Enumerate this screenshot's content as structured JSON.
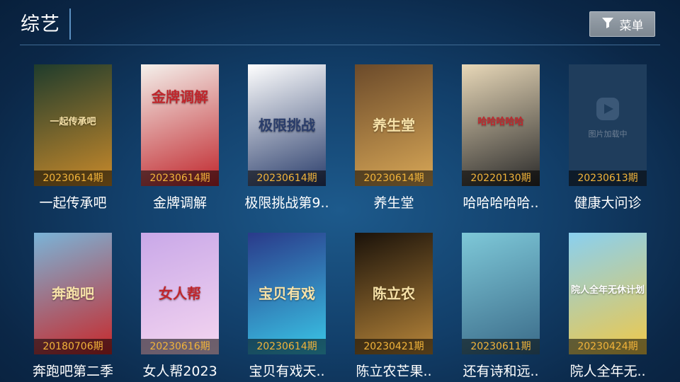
{
  "header": {
    "title": "综艺",
    "menu_label": "菜单",
    "menu_icon": "filter-icon"
  },
  "items": [
    {
      "title": "一起传承吧",
      "episode": "20230614期",
      "poster_text": "一起传承吧",
      "colors": [
        "#1f3c2c",
        "#c98a2b"
      ]
    },
    {
      "title": "金牌调解",
      "episode": "20230614期",
      "poster_text": "金牌调解",
      "colors": [
        "#f4f1ec",
        "#c0262c"
      ]
    },
    {
      "title": "极限挑战第9..",
      "episode": "20230614期",
      "poster_text": "极限挑战",
      "colors": [
        "#ffffff",
        "#2a3d6b"
      ]
    },
    {
      "title": "养生堂",
      "episode": "20230614期",
      "poster_text": "养生堂",
      "colors": [
        "#6b4a2a",
        "#d9a857"
      ]
    },
    {
      "title": "哈哈哈哈哈..",
      "episode": "20220130期",
      "poster_text": "哈哈哈哈哈",
      "colors": [
        "#e8d8b8",
        "#2a2a2a"
      ]
    },
    {
      "title": "健康大问诊",
      "episode": "20230613期",
      "poster_text": "图片加载中",
      "colors": [
        "#1d3a5a",
        "#2a4a6a"
      ]
    },
    {
      "title": "奔跑吧第二季",
      "episode": "20180706期",
      "poster_text": "奔跑吧",
      "colors": [
        "#7ab4d8",
        "#c8282a"
      ]
    },
    {
      "title": "女人帮2023",
      "episode": "20230616期",
      "poster_text": "女人帮",
      "colors": [
        "#c9a8e8",
        "#f5d6f0"
      ]
    },
    {
      "title": "宝贝有戏天..",
      "episode": "20230614期",
      "poster_text": "宝贝有戏",
      "colors": [
        "#2a3a8a",
        "#3ac8e8"
      ]
    },
    {
      "title": "陈立农芒果..",
      "episode": "20230421期",
      "poster_text": "陈立农",
      "colors": [
        "#1a120a",
        "#b8863a"
      ]
    },
    {
      "title": "还有诗和远..",
      "episode": "20230611期",
      "poster_text": "",
      "colors": [
        "#7ec8d8",
        "#3a6a88"
      ]
    },
    {
      "title": "院人全年无..",
      "episode": "20230424期",
      "poster_text": "院人全年无休计划",
      "colors": [
        "#8ad0f0",
        "#f0c848"
      ]
    }
  ]
}
